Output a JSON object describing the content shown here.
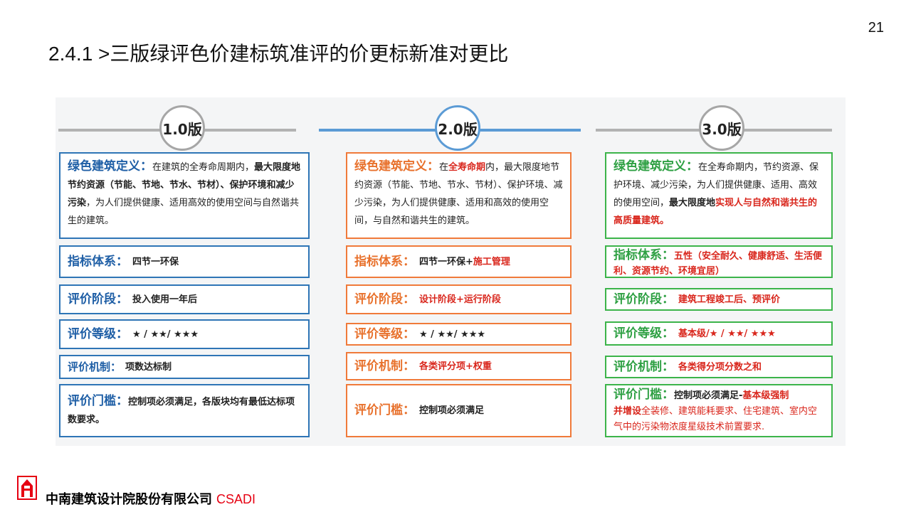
{
  "page_number": "21",
  "title": "2.4.1 >三版绿评色价建标筑准评的价更标新准对更比",
  "columns": [
    {
      "version": "1.0版",
      "definition": {
        "label": "绿色建筑定义：",
        "t1": "在建筑的全寿命周期内，",
        "t2": "最大限度地节约资源（节能、节地、节水、节材）、保护环境和减少污染",
        "t3": "，为人们提供健康、适用高效的使用空间与自然谐共生的建筑。"
      },
      "rows": [
        {
          "label": "指标体系：",
          "value": "四节一环保"
        },
        {
          "label": "评价阶段：",
          "value": "投入使用一年后"
        },
        {
          "label": "评价等级：",
          "value": "★ / ★★/ ★★★"
        },
        {
          "label": "评价机制：",
          "value": "项数达标制"
        },
        {
          "label": "评价门槛：",
          "value": "控制项必须满足，各版块均有最低达标项数要求。"
        }
      ]
    },
    {
      "version": "2.0版",
      "definition": {
        "label": "绿色建筑定义：",
        "t1": "在",
        "t2": "全寿命期",
        "t3": "内，最大限度地节约资源（节能、节地、节水、节材）、保护环境、减少污染，为人们提供健康、适用和高效的使用空间，与自然和谐共生的建筑。"
      },
      "rows": [
        {
          "label": "指标体系：",
          "value": "四节一环保+",
          "value_red": "施工管理"
        },
        {
          "label": "评价阶段：",
          "value": "设计阶段+运行阶段"
        },
        {
          "label": "评价等级：",
          "value": "★ / ★★/ ★★★"
        },
        {
          "label": "评价机制：",
          "value": "各类评分项+权重"
        },
        {
          "label": "评价门槛：",
          "value": "控制项必须满足"
        }
      ]
    },
    {
      "version": "3.0版",
      "definition": {
        "label": "绿色建筑定义：",
        "t1": "在全寿命期内，节约资源、保护环境、减少污染，为人们提供健康、适用、高效的使用空间，",
        "t2": "最大限度地",
        "t3": "实现人与自然和谐共生的高质量建筑。"
      },
      "rows": [
        {
          "label": "指标体系：",
          "value": "五性（安全耐久、健康舒适、生活便利、资源节约、环境宜居）"
        },
        {
          "label": "评价阶段：",
          "value": "建筑工程竣工后、预评价"
        },
        {
          "label": "评价等级：",
          "value": "基本级/★ / ★★/ ★★★"
        },
        {
          "label": "评价机制：",
          "value": "各类得分项分数之和"
        },
        {
          "label": "评价门槛：",
          "value": "控制项必须满足-",
          "value_red": "基本级强制",
          "extra_red": "并增设",
          "extra": "全装修、建筑能耗要求、住宅建筑、室内空气中的污染物浓度星级技术前置要求."
        }
      ]
    }
  ],
  "footer": {
    "company": "中南建筑设计院股份有限公司",
    "brand": "CSADI"
  }
}
